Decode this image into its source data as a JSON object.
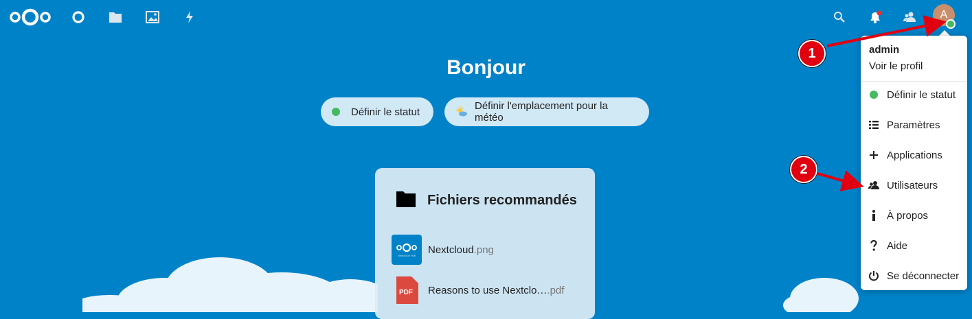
{
  "header": {
    "icons": [
      "nextcloud-logo",
      "dashboard-icon",
      "files-icon",
      "photos-icon",
      "activity-icon",
      "search-icon",
      "notifications-icon",
      "contacts-icon"
    ],
    "avatar_letter": "A"
  },
  "main": {
    "greeting": "Bonjour",
    "status_button": "Définir le statut",
    "weather_button": "Définir l'emplacement pour la météo",
    "recommended": {
      "title": "Fichiers recommandés",
      "files": [
        {
          "name": "Nextcloud",
          "ext": ".png",
          "thumb_caption": "Nextcloud Hub"
        },
        {
          "name": "Reasons to use Nextclo…",
          "ext": ".pdf",
          "icon_label": "PDF"
        }
      ]
    }
  },
  "user_menu": {
    "username": "admin",
    "profile": "Voir le profil",
    "items": [
      {
        "label": "Définir le statut",
        "icon": "status-dot-icon"
      },
      {
        "label": "Paramètres",
        "icon": "settings-list-icon"
      },
      {
        "label": "Applications",
        "icon": "plus-icon"
      },
      {
        "label": "Utilisateurs",
        "icon": "users-icon"
      },
      {
        "label": "À propos",
        "icon": "info-icon"
      },
      {
        "label": "Aide",
        "icon": "help-icon"
      },
      {
        "label": "Se déconnecter",
        "icon": "power-icon"
      }
    ]
  },
  "annotations": [
    "1",
    "2"
  ],
  "colors": {
    "background": "#0082c9",
    "status_green": "#46ba61",
    "annotation_red": "#e0000f",
    "notification_dot": "#e9322d",
    "avatar": "#c98f6c"
  }
}
